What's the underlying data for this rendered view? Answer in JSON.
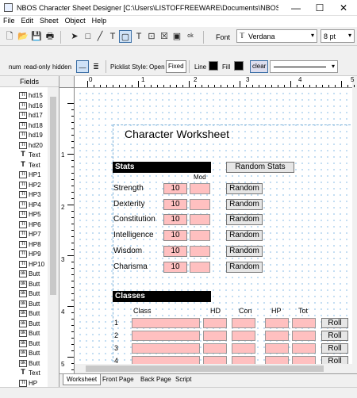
{
  "window": {
    "title": "NBOS Character Sheet Designer [C:\\Users\\LISTOFFREEWARE\\Documents\\NBOS Character S...",
    "minimize": "—",
    "maximize": "☐",
    "close": "✕"
  },
  "menu": [
    "File",
    "Edit",
    "Sheet",
    "Object",
    "Help"
  ],
  "toolbar": {
    "font_label": "Font",
    "font_value": "Verdana",
    "size_value": "8 pt"
  },
  "toolbar2": {
    "num": "num",
    "readonly": "read-only",
    "hidden": "hidden",
    "picklist_label": "Picklist Style:",
    "open": "Open",
    "fixed": "Fixed",
    "line": "Line",
    "fill": "Fill",
    "clear": "clear"
  },
  "fields": {
    "header": "Fields",
    "items": [
      {
        "icon": "TI",
        "label": "hd15"
      },
      {
        "icon": "TI",
        "label": "hd16"
      },
      {
        "icon": "TI",
        "label": "hd17"
      },
      {
        "icon": "TI",
        "label": "hd18"
      },
      {
        "icon": "TI",
        "label": "hd19"
      },
      {
        "icon": "TI",
        "label": "hd20"
      },
      {
        "icon": "T",
        "label": "Text"
      },
      {
        "icon": "T",
        "label": "Text"
      },
      {
        "icon": "TI",
        "label": "HP1"
      },
      {
        "icon": "TI",
        "label": "HP2"
      },
      {
        "icon": "TI",
        "label": "HP3"
      },
      {
        "icon": "TI",
        "label": "HP4"
      },
      {
        "icon": "TI",
        "label": "HP5"
      },
      {
        "icon": "TI",
        "label": "HP6"
      },
      {
        "icon": "TI",
        "label": "HP7"
      },
      {
        "icon": "TI",
        "label": "HP8"
      },
      {
        "icon": "TI",
        "label": "HP9"
      },
      {
        "icon": "TI",
        "label": "HP10"
      },
      {
        "icon": "ok",
        "label": "Butt"
      },
      {
        "icon": "ok",
        "label": "Butt"
      },
      {
        "icon": "ok",
        "label": "Butt"
      },
      {
        "icon": "ok",
        "label": "Butt"
      },
      {
        "icon": "ok",
        "label": "Butt"
      },
      {
        "icon": "ok",
        "label": "Butt"
      },
      {
        "icon": "ok",
        "label": "Butt"
      },
      {
        "icon": "ok",
        "label": "Butt"
      },
      {
        "icon": "ok",
        "label": "Butt"
      },
      {
        "icon": "ok",
        "label": "Butt"
      },
      {
        "icon": "T",
        "label": "Text"
      },
      {
        "icon": "TI",
        "label": "HP"
      }
    ]
  },
  "ruler": {
    "h": [
      "0",
      "1",
      "2",
      "3",
      "4",
      "5"
    ],
    "v": [
      "1",
      "2",
      "3",
      "4",
      "5"
    ]
  },
  "sheet": {
    "title": "Character Worksheet",
    "stats_header": "Stats",
    "random_stats": "Random Stats",
    "mod_label": "Mod",
    "stats": [
      {
        "name": "Strength",
        "value": "10",
        "btn": "Random"
      },
      {
        "name": "Dexterity",
        "value": "10",
        "btn": "Random"
      },
      {
        "name": "Constitution",
        "value": "10",
        "btn": "Random"
      },
      {
        "name": "Intelligence",
        "value": "10",
        "btn": "Random"
      },
      {
        "name": "Wisdom",
        "value": "10",
        "btn": "Random"
      },
      {
        "name": "Charisma",
        "value": "10",
        "btn": "Random"
      }
    ],
    "classes_header": "Classes",
    "class_cols": [
      "Class",
      "HD",
      "Con",
      "HP",
      "Tot"
    ],
    "class_rows": [
      {
        "n": "1",
        "btn": "Roll"
      },
      {
        "n": "2",
        "btn": "Roll"
      },
      {
        "n": "3",
        "btn": "Roll"
      },
      {
        "n": "4",
        "btn": "Roll"
      }
    ]
  },
  "tabs": [
    "Worksheet",
    "Front Page",
    "Back Page",
    "Script"
  ]
}
